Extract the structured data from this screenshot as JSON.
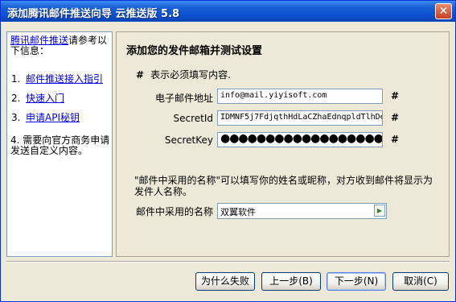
{
  "window": {
    "title": "添加腾讯邮件推送向导 云推送版 5.8",
    "close_label": "✕"
  },
  "sidebar": {
    "intro_link": "腾讯邮件推送",
    "intro_rest": "请参考以下信息：",
    "steps": [
      {
        "num": "1.",
        "label": "邮件推送接入指引"
      },
      {
        "num": "2.",
        "label": "快速入门"
      },
      {
        "num": "3.",
        "label": "申请API秘钥"
      },
      {
        "num": "4.",
        "label": "需要向官方商务申请发送自定义内容。"
      }
    ]
  },
  "main": {
    "heading": "添加您的发件邮箱并测试设置",
    "required_mark": "#",
    "required_note": "表示必须填写内容.",
    "email_label": "电子邮件地址",
    "email_value": "info@mail.yiyisoft.com",
    "secret_id_label": "SecretId",
    "secret_id_value": "IDMNF5j7FdjqthHdLaCZhaEdnqpldTlhDe",
    "secret_key_label": "SecretKey",
    "secret_key_value": "●●●●●●●●●●●●●●●●●●●●●",
    "description": "\"邮件中采用的名称\"可以填写你的姓名或昵称，对方收到邮件将显示为发件人名称。",
    "sender_name_label": "邮件中采用的名称",
    "sender_name_value": "双翼软件",
    "dropdown_icon": "▶"
  },
  "buttons": {
    "why_fail": "为什么失败",
    "back": "上一步(B)",
    "next": "下一步(N)",
    "cancel": "取消(C)"
  }
}
